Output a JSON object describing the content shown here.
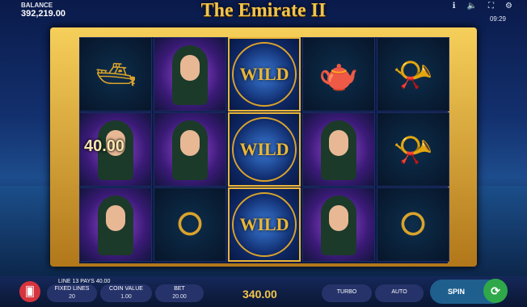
{
  "title": "The Emirate II",
  "balance": {
    "label": "BALANCE",
    "value": "392,219.00"
  },
  "clock": "09:29",
  "icons": {
    "info": "info-icon",
    "sound": "speaker-icon",
    "fullscreen": "fullscreen-icon",
    "settings": "gear-icon"
  },
  "reels": [
    [
      "yacht",
      "woman",
      "woman"
    ],
    [
      "woman",
      "woman",
      "necklace"
    ],
    [
      "wild",
      "wild",
      "wild"
    ],
    [
      "teapot",
      "woman",
      "woman"
    ],
    [
      "horn",
      "horn",
      "necklace"
    ]
  ],
  "symbol_labels": {
    "wild": "WILD"
  },
  "win_overlay": "40.00",
  "bottom": {
    "status": "LINE 13 PAYS 40.00",
    "fixed_lines_label": "FIXED LINES",
    "fixed_lines_value": "20",
    "coin_value_label": "COIN VALUE",
    "coin_value": "1.00",
    "bet_label": "BET",
    "bet_value": "20.00",
    "win": "340.00",
    "turbo": "TURBO",
    "auto": "AUTO",
    "spin": "SPIN"
  },
  "colors": {
    "gold": "#f2c44c",
    "menu": "#d6333d",
    "spin": "#2fa84a"
  }
}
